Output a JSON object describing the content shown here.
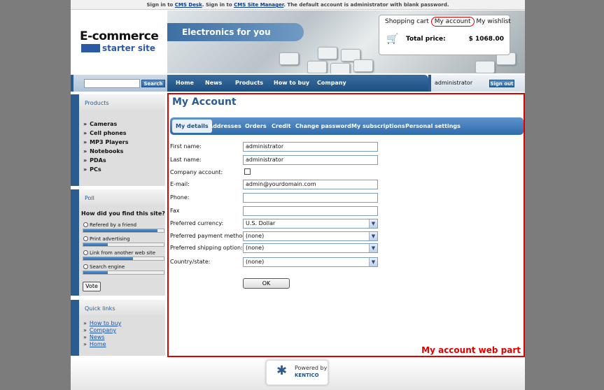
{
  "topbar": {
    "t1": "Sign in to ",
    "l1": "CMS Desk",
    "t2": ". Sign in to ",
    "l2": "CMS Site Manager",
    "t3": ". The default account is administrator with blank password."
  },
  "logo": {
    "line1": "E-commerce",
    "line2": "starter site"
  },
  "hero": {
    "tagline": "Electronics for you"
  },
  "cart": {
    "shopping_cart": "Shopping cart",
    "my_account": "My account",
    "my_wishlist": "My wishlist",
    "total_label": "Total price:",
    "total_value": "$ 1068.00"
  },
  "search": {
    "button": "Search",
    "value": ""
  },
  "nav": [
    "Home",
    "News",
    "Products",
    "How to buy",
    "Company"
  ],
  "user": {
    "name": "administrator",
    "signout": "Sign out"
  },
  "products": {
    "title": "Products",
    "items": [
      "Cameras",
      "Cell phones",
      "MP3 Players",
      "Notebooks",
      "PDAs",
      "PCs"
    ]
  },
  "poll": {
    "title": "Poll",
    "question": "How did you find this site?",
    "options": [
      {
        "label": "Refered by a friend",
        "share": 0.92
      },
      {
        "label": "Print advertising",
        "share": 0.3
      },
      {
        "label": "Link from another web site",
        "share": 0.62
      },
      {
        "label": "Search engine",
        "share": 0.3
      }
    ],
    "vote": "Vote"
  },
  "quicklinks": {
    "title": "Quick links",
    "items": [
      "How to buy",
      "Company",
      "News",
      "Home"
    ]
  },
  "account": {
    "title": "My Account",
    "tabs": [
      "My details",
      "Addresses",
      "Orders",
      "Credit",
      "Change password",
      "My subscriptions",
      "Personal settings"
    ],
    "fields": {
      "first_name": {
        "label": "First name:",
        "value": "administrator"
      },
      "last_name": {
        "label": "Last name:",
        "value": "administrator"
      },
      "company": {
        "label": "Company account:"
      },
      "email": {
        "label": "E-mail:",
        "value": "admin@yourdomain.com"
      },
      "phone": {
        "label": "Phone:",
        "value": ""
      },
      "fax": {
        "label": "Fax",
        "value": ""
      },
      "currency": {
        "label": "Preferred currency:",
        "value": "U.S. Dollar"
      },
      "payment": {
        "label": "Preferred payment method:",
        "value": "(none)"
      },
      "shipping": {
        "label": "Preferred shipping option:",
        "value": "(none)"
      },
      "country": {
        "label": "Country/state:",
        "value": "(none)"
      }
    },
    "ok": "OK",
    "webpart_label": "My account web part"
  },
  "footer": {
    "powered": "Powered by",
    "brand": "KENTICO"
  }
}
